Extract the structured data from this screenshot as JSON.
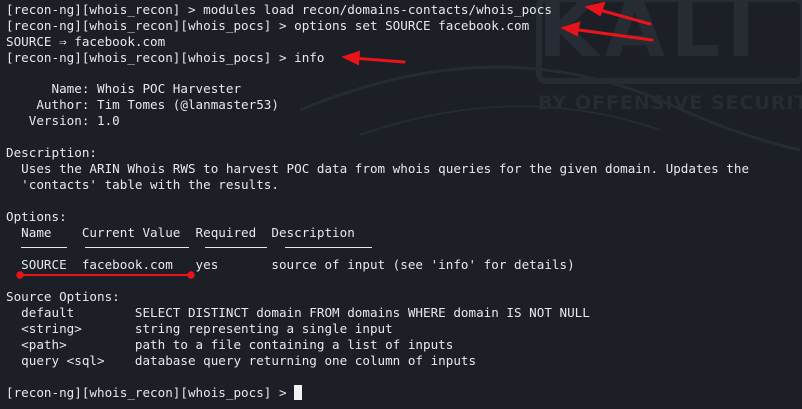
{
  "watermark": {
    "logo": "KALI",
    "tagline": "BY OFFENSIVE SECURITY"
  },
  "lines": {
    "l1": "[recon-ng][whois_recon] > modules load recon/domains-contacts/whois_pocs",
    "l2": "[recon-ng][whois_recon][whois_pocs] > options set SOURCE facebook.com",
    "l3": "SOURCE ⇒ facebook.com",
    "l4": "[recon-ng][whois_recon][whois_pocs] > info",
    "name": "      Name: Whois POC Harvester",
    "author": "    Author: Tim Tomes (@lanmaster53)",
    "version": "   Version: 1.0",
    "desc_h": "Description:",
    "desc1": "  Uses the ARIN Whois RWS to harvest POC data from whois queries for the given domain. Updates the",
    "desc2": "  'contacts' table with the results.",
    "opt_h": "Options:",
    "opt_cols": "  Name    Current Value  Required  Description",
    "opt_row": "  SOURCE  facebook.com   yes       source of input (see 'info' for details)",
    "src_h": "Source Options:",
    "src1": "  default        SELECT DISTINCT domain FROM domains WHERE domain IS NOT NULL",
    "src2": "  <string>       string representing a single input",
    "src3": "  <path>         path to a file containing a list of inputs",
    "src4": "  query <sql>    database query returning one column of inputs",
    "prompt": "[recon-ng][whois_recon][whois_pocs] > "
  },
  "colors": {
    "background": "#1c1f26",
    "text": "#e6e8ec",
    "annotation": "#e8141a"
  }
}
